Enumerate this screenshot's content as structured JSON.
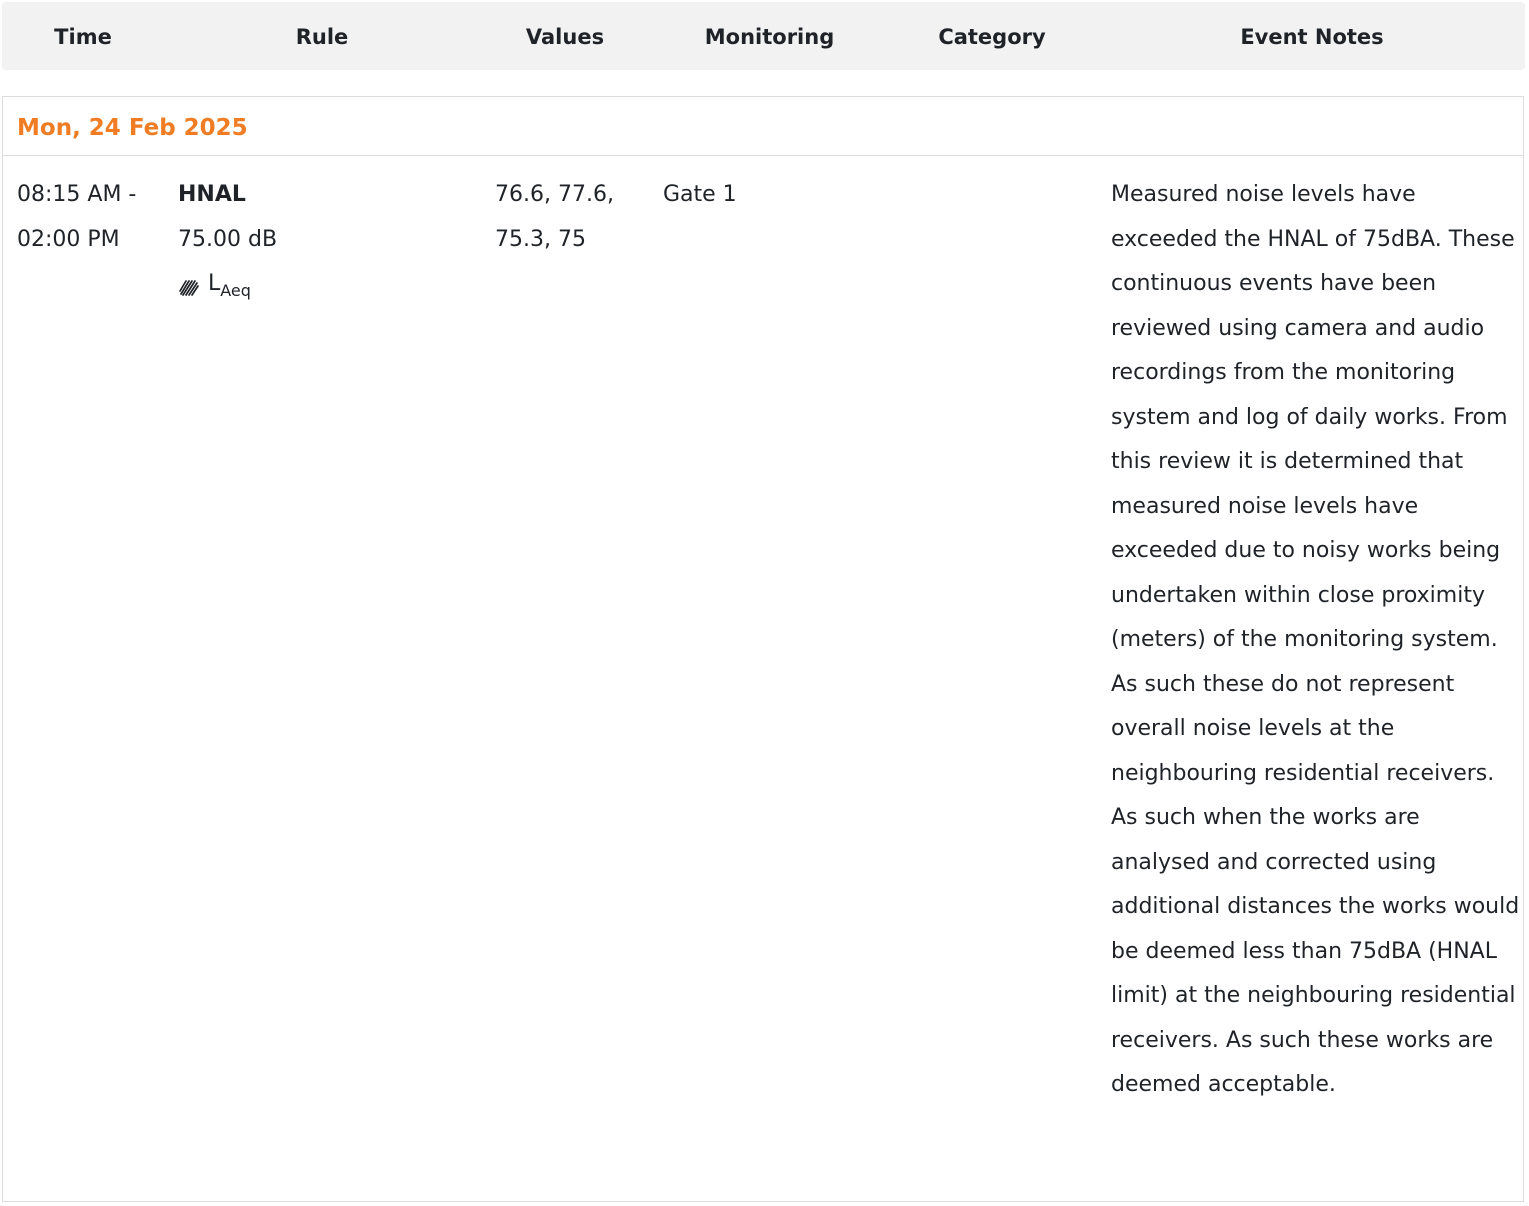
{
  "columns": {
    "time": "Time",
    "rule": "Rule",
    "values": "Values",
    "monitoring": "Monitoring",
    "category": "Category",
    "event_notes": "Event Notes"
  },
  "colors": {
    "date_accent": "#f07d23",
    "header_bg": "#f2f2f2",
    "border": "#dcdcdc"
  },
  "groups": [
    {
      "date": "Mon, 24 Feb 2025",
      "events": [
        {
          "time_start": "08:15 AM -",
          "time_end": "02:00 PM",
          "rule_name": "HNAL",
          "rule_threshold": "75.00 dB",
          "rule_metric_icon": "hatched-sound-icon",
          "rule_metric_main": "L",
          "rule_metric_sub": "Aeq",
          "values_line1": "76.6, 77.6,",
          "values_line2": "75.3, 75",
          "monitoring": "Gate 1",
          "category": "",
          "notes": "Measured noise levels have exceeded the HNAL of 75dBA. These continuous events have been reviewed using camera and audio recordings from the monitoring system and log of daily works. From this review it is determined that measured noise levels have exceeded due to noisy works being undertaken within close proximity (meters) of the monitoring system. As such these do not represent overall noise levels at the neighbouring residential receivers. As such when the works are analysed and corrected using additional distances the works would be deemed less than 75dBA (HNAL limit) at the neighbouring residential receivers. As such these works are deemed acceptable."
        }
      ]
    }
  ]
}
